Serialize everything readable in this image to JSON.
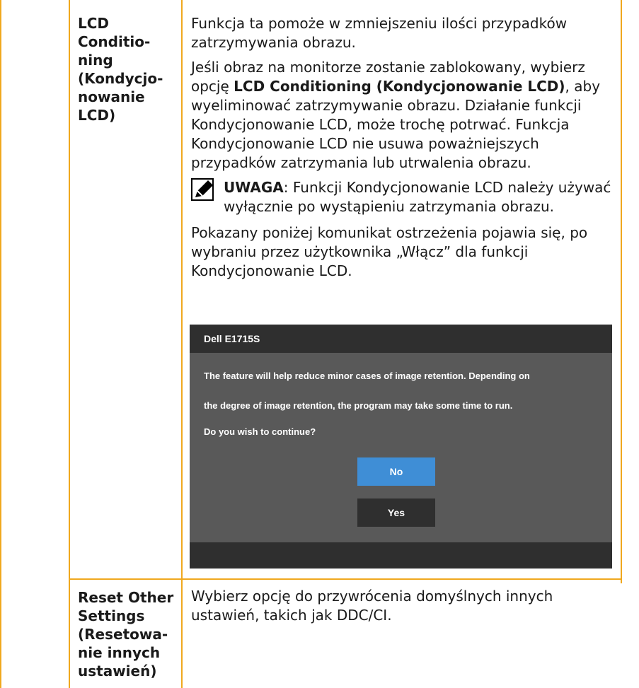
{
  "row1": {
    "label": "LCD\nConditio-\nning\n(Kondycjo-\nnowanie\nLCD)",
    "p1": "Funkcja ta pomoże w zmniejszeniu ilości przypadków zatrzymywania obrazu.",
    "p2_pre": "Jeśli obraz na monitorze zostanie zablokowany, wybierz opcję ",
    "p2_bold": "LCD Conditioning (Kondycjonowanie LCD)",
    "p2_post": ", aby wyeliminować zatrzymywanie obrazu. Działanie funkcji Kondycjonowanie LCD, może trochę potrwać. Funkcja Kondycjonowanie LCD nie usuwa poważniejszych przypadków zatrzymania lub utrwalenia obrazu.",
    "note_label": "UWAGA",
    "note_text": ": Funkcji Kondycjonowanie LCD należy używać wyłącznie po wystąpieniu zatrzymania obrazu.",
    "p3": "Pokazany poniżej komunikat ostrzeżenia pojawia się, po wybraniu przez użytkownika „Włącz” dla funkcji Kondycjonowanie LCD."
  },
  "dialog": {
    "title": "Dell E1715S",
    "line1": "The feature will help reduce minor cases of image retention. Depending on",
    "line2": "the degree of image retention, the program may take some time to run.",
    "line3": "Do you wish to continue?",
    "no_label": "No",
    "yes_label": "Yes"
  },
  "row2": {
    "label": "Reset Other\nSettings\n(Resetowa-\nnie innych\nustawień)",
    "desc": "Wybierz opcję do przywrócenia domyślnych innych ustawień, takich jak DDC/CI."
  },
  "colors": {
    "border": "#f0a81e",
    "dialog_bg": "#595959",
    "dialog_bar": "#2f2f2f",
    "no_button": "#3f8ed6"
  }
}
